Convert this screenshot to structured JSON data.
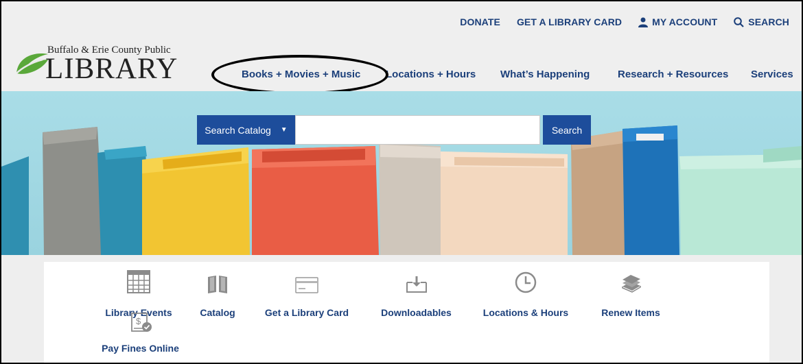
{
  "utility_nav": {
    "donate": "DONATE",
    "library_card": "GET A LIBRARY CARD",
    "my_account": "MY ACCOUNT",
    "search": "SEARCH"
  },
  "logo": {
    "line1": "Buffalo & Erie County Public",
    "line2": "LIBRARY"
  },
  "main_nav": [
    "Books + Movies + Music",
    "Locations + Hours",
    "What’s Happening",
    "Research + Resources",
    "Services"
  ],
  "catalog_search": {
    "scope_label": "Search Catalog",
    "button_label": "Search",
    "query": ""
  },
  "quick_links": [
    {
      "label": "Library Events",
      "icon": "calendar-icon"
    },
    {
      "label": "Catalog",
      "icon": "open-book-icon"
    },
    {
      "label": "Get a Library Card",
      "icon": "library-card-icon"
    },
    {
      "label": "Downloadables",
      "icon": "download-tray-icon"
    },
    {
      "label": "Locations & Hours",
      "icon": "clock-icon"
    },
    {
      "label": "Renew Items",
      "icon": "book-stack-icon"
    },
    {
      "label": "Pay Fines Online",
      "icon": "pay-fines-icon"
    }
  ],
  "colors": {
    "brand_blue": "#1d4d9b",
    "link_navy": "#1b3f7a",
    "hero_sky": "#a7dce6",
    "logo_green": "#5aa83a"
  }
}
